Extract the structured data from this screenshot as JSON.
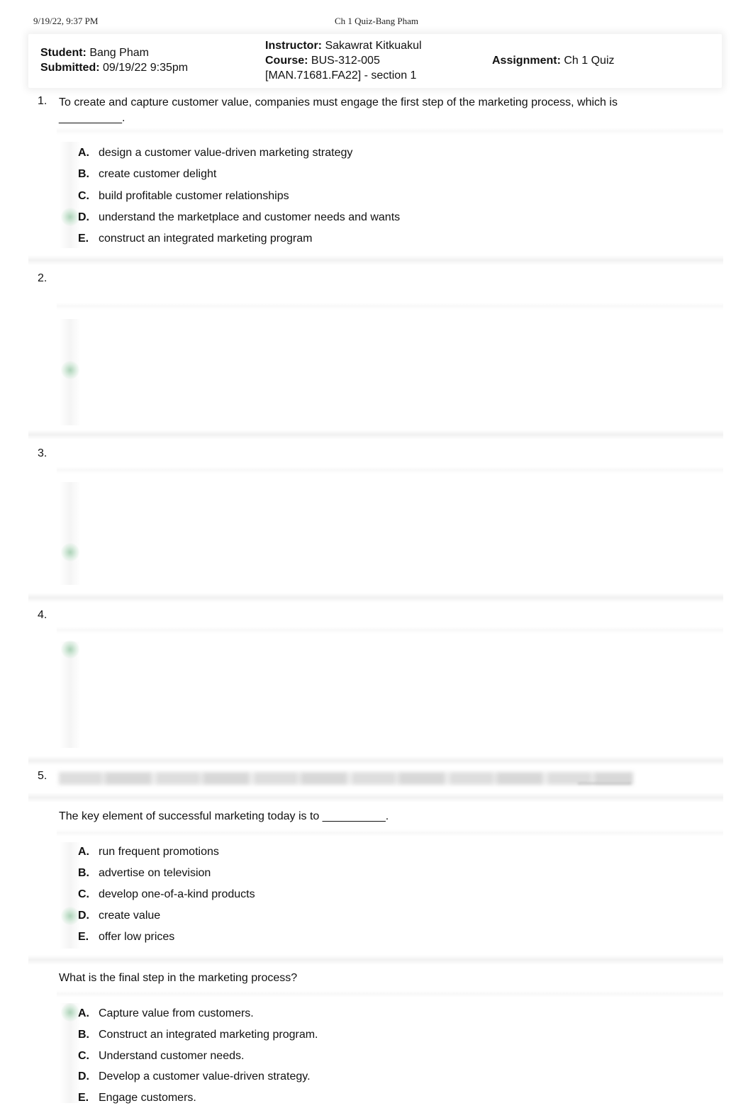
{
  "print_header": {
    "date": "9/19/22, 9:37 PM",
    "title": "Ch 1 Quiz-Bang Pham"
  },
  "info": {
    "student_label": "Student:",
    "student": "Bang Pham",
    "submitted_label": "Submitted:",
    "submitted": "09/19/22 9:35pm",
    "instructor_label": "Instructor:",
    "instructor": "Sakawrat Kitkuakul",
    "course_label": "Course:",
    "course": "BUS-312-005",
    "course_section": "[MAN.71681.FA22] - section 1",
    "assignment_label": "Assignment:",
    "assignment": "Ch 1 Quiz"
  },
  "questions": [
    {
      "number": "1.",
      "text": "To create and capture customer value, companies must engage the first step of the marketing process, which is __________.",
      "options": [
        {
          "letter": "A.",
          "text": "design a customer value-driven marketing strategy"
        },
        {
          "letter": "B.",
          "text": "create customer delight"
        },
        {
          "letter": "C.",
          "text": "build profitable customer relationships"
        },
        {
          "letter": "D.",
          "text": "understand the marketplace and customer needs and wants"
        },
        {
          "letter": "E.",
          "text": "construct an integrated marketing program"
        }
      ],
      "marked_option": "D.",
      "marker_icon": "correct-answer-indicator"
    },
    {
      "number": "2.",
      "text": "",
      "blurred": true,
      "marked_option_index": 2,
      "marker_icon": "correct-answer-indicator"
    },
    {
      "number": "3.",
      "text": "",
      "blurred": true,
      "marked_option_index": 3,
      "marker_icon": "correct-answer-indicator"
    },
    {
      "number": "4.",
      "text": "",
      "blurred": true,
      "marked_option_index": 0,
      "marker_icon": "correct-answer-indicator"
    },
    {
      "number": "5.",
      "text": "",
      "blurred": true,
      "sub_questions": [
        {
          "text": "The key element of successful marketing today is to __________.",
          "options": [
            {
              "letter": "A.",
              "text": "run frequent promotions"
            },
            {
              "letter": "B.",
              "text": "advertise on television"
            },
            {
              "letter": "C.",
              "text": "develop one-of-a-kind products"
            },
            {
              "letter": "D.",
              "text": "create value"
            },
            {
              "letter": "E.",
              "text": "offer low prices"
            }
          ],
          "marked_option": "D."
        },
        {
          "text": "What is the final step in the marketing process?",
          "options": [
            {
              "letter": "A.",
              "text": "Capture value from customers."
            },
            {
              "letter": "B.",
              "text": "Construct an integrated marketing program."
            },
            {
              "letter": "C.",
              "text": "Understand customer needs."
            },
            {
              "letter": "D.",
              "text": "Develop a customer value-driven strategy."
            },
            {
              "letter": "E.",
              "text": "Engage customers."
            }
          ],
          "marked_option": "A."
        }
      ]
    }
  ]
}
